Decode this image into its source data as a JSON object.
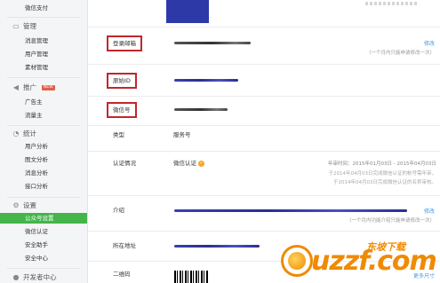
{
  "sidebar": {
    "top_item": "微信支付",
    "groups": [
      {
        "title": "管理",
        "icon": "chat-icon",
        "items": [
          "消息管理",
          "用户管理",
          "素材管理"
        ]
      },
      {
        "title": "推广",
        "icon": "megaphone-icon",
        "badge": "NEW",
        "items": [
          "广告主",
          "流量主"
        ]
      },
      {
        "title": "统计",
        "icon": "chart-icon",
        "items": [
          "用户分析",
          "图文分析",
          "消息分析",
          "接口分析"
        ]
      },
      {
        "title": "设置",
        "icon": "gear-icon",
        "items": [
          "公众号设置",
          "微信认证",
          "安全助手",
          "安全中心"
        ]
      },
      {
        "title": "开发者中心",
        "icon": "developer-icon",
        "items": []
      }
    ],
    "active_item": "公众号设置"
  },
  "account": {
    "login_email_label": "登录邮箱",
    "original_id_label": "原始ID",
    "wechat_id_label": "微信号",
    "type_label": "类型",
    "type_value": "服务号",
    "verification_label": "认证情况",
    "verification_value": "微信认证",
    "verification_note_1": "年审时间：2015年01月03日 - 2015年04月03日",
    "verification_note_2": "于2014年04月03日完成微信认证的帐号需年审，",
    "verification_note_3": "于2014年04月03日完成微信认证的名称审核。",
    "intro_label": "介绍",
    "address_label": "所在地址",
    "qrcode_label": "二维码",
    "edit": "修改",
    "hint_once_month": "（一个月内只能申请修改一次）",
    "hint_once_month_func": "（一个月内功能介绍只能申请修改一次）",
    "more_sizes": "更多尺寸"
  },
  "watermark": {
    "cn": "东坡下载",
    "brand": "uzzf.com"
  },
  "colors": {
    "accent": "#44b549",
    "highlight_box": "#c0272d",
    "link": "#459ae9",
    "redaction": "#2e39a8",
    "watermark": "#f08a00"
  }
}
